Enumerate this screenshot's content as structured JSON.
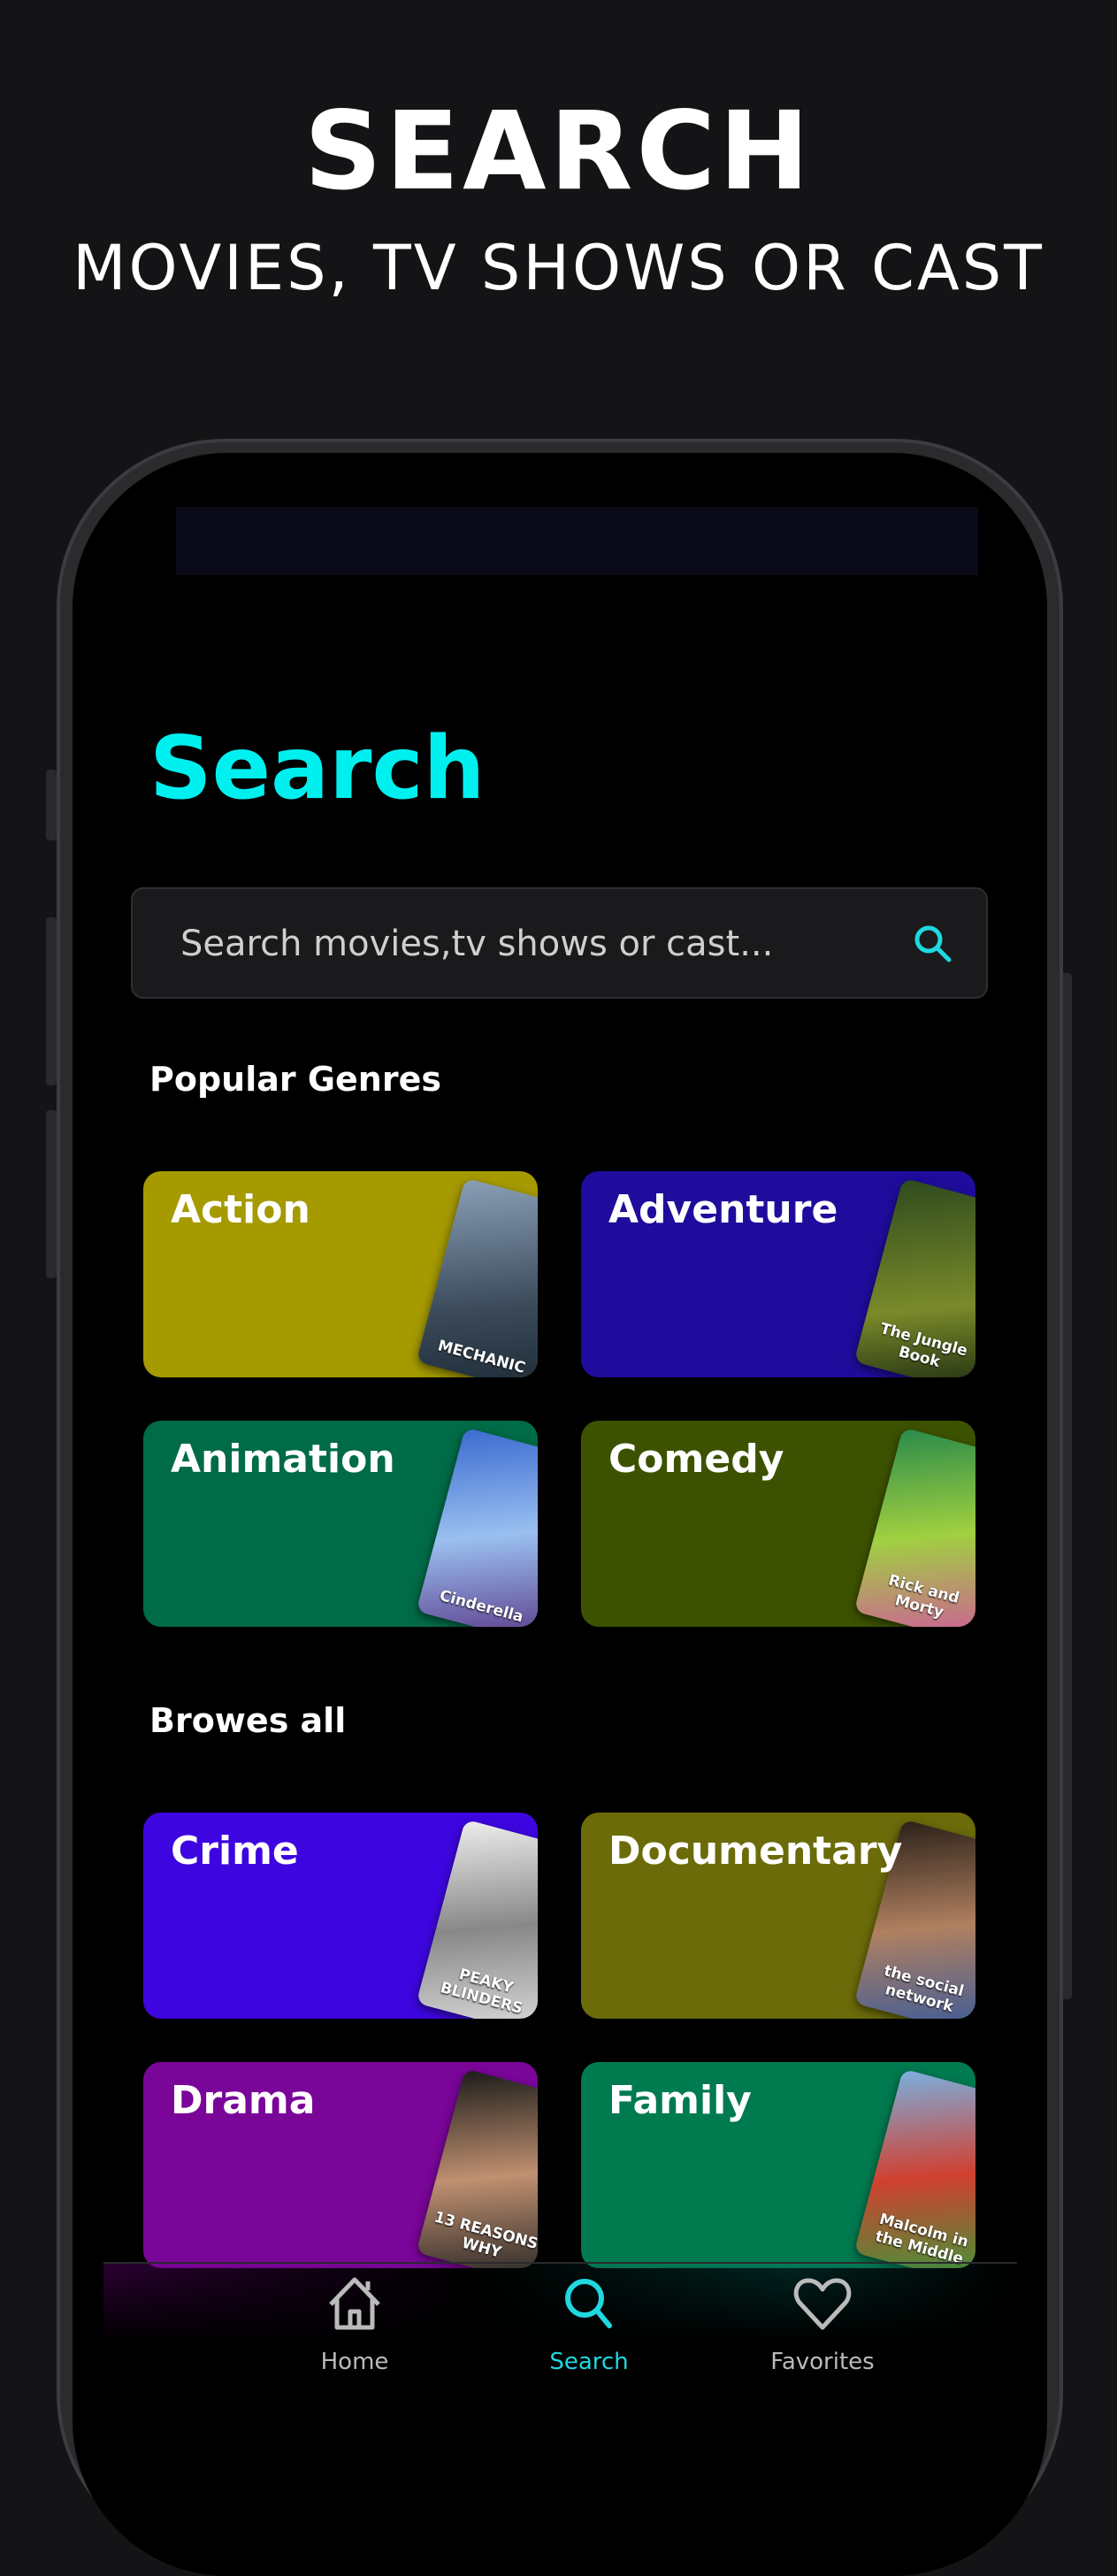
{
  "promo": {
    "headline": "SEARCH",
    "subheadline": "MOVIES, TV SHOWS OR CAST"
  },
  "screen": {
    "title": "Search",
    "search": {
      "placeholder": "Search movies,tv shows or cast...",
      "value": ""
    },
    "popular_section": "Popular Genres",
    "popular_genres": [
      {
        "label": "Action",
        "color": "#a59a00",
        "poster": "MECHANIC"
      },
      {
        "label": "Adventure",
        "color": "#1f0c9c",
        "poster": "The Jungle Book"
      },
      {
        "label": "Animation",
        "color": "#006b47",
        "poster": "Cinderella"
      },
      {
        "label": "Comedy",
        "color": "#3d5200",
        "poster": "Rick and Morty"
      }
    ],
    "browse_section": "Browes all",
    "browse_genres": [
      {
        "label": "Crime",
        "color": "#3d06e0",
        "poster": "PEAKY BLINDERS"
      },
      {
        "label": "Documentary",
        "color": "#6b6b0a",
        "poster": "the social network"
      },
      {
        "label": "Drama",
        "color": "#7a0599",
        "poster": "13 REASONS WHY"
      },
      {
        "label": "Family",
        "color": "#007a4f",
        "poster": "Malcolm in the Middle"
      }
    ],
    "nav": [
      {
        "label": "Home",
        "icon": "home-icon",
        "active": false
      },
      {
        "label": "Search",
        "icon": "search-icon",
        "active": true
      },
      {
        "label": "Favorites",
        "icon": "heart-icon",
        "active": false
      }
    ],
    "accent": "#00f0f0"
  }
}
